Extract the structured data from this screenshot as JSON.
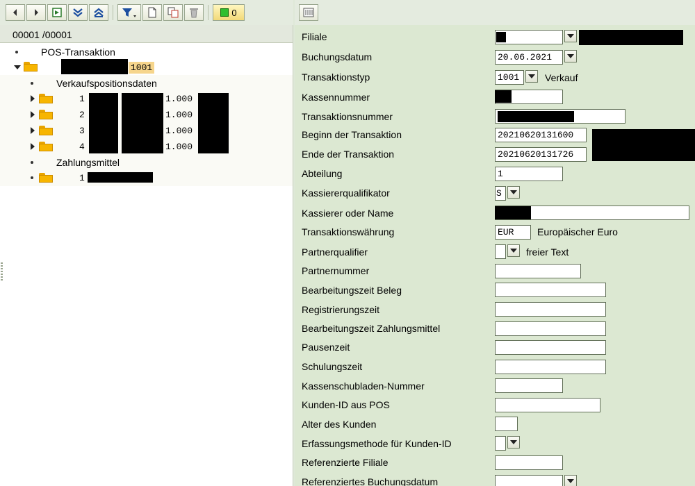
{
  "toolbar": {
    "counter_value": "0"
  },
  "tree": {
    "header": "00001 /00001",
    "root_label": "POS-Transaktion",
    "transaction_number": "1001",
    "sections": {
      "items_label": "Verkaufspositionsdaten",
      "payment_label": "Zahlungsmittel"
    },
    "items": [
      {
        "index": "1",
        "quantity": "1.000"
      },
      {
        "index": "2",
        "quantity": "1.000"
      },
      {
        "index": "3",
        "quantity": "1.000"
      },
      {
        "index": "4",
        "quantity": "1.000"
      }
    ],
    "payment_index": "1"
  },
  "form": {
    "labels": {
      "filiale": "Filiale",
      "buchungsdatum": "Buchungsdatum",
      "transaktionstyp": "Transaktionstyp",
      "kassennummer": "Kassennummer",
      "transaktionsnummer": "Transaktionsnummer",
      "beginn": "Beginn der Transaktion",
      "ende": "Ende der Transaktion",
      "abteilung": "Abteilung",
      "kassiererqualifikator": "Kassiererqualifikator",
      "kassierer": "Kassierer oder Name",
      "waehrung": "Transaktionswährung",
      "partnerqualifier": "Partnerqualifier",
      "partnernummer": "Partnernummer",
      "bz_beleg": "Bearbeitungszeit Beleg",
      "registrierungszeit": "Registrierungszeit",
      "bz_zahlungsmittel": "Bearbeitungszeit Zahlungsmittel",
      "pausenzeit": "Pausenzeit",
      "schulungszeit": "Schulungszeit",
      "schublade": "Kassenschubladen-Nummer",
      "kunden_id": "Kunden-ID aus POS",
      "alter": "Alter des Kunden",
      "erfassungsmethode": "Erfassungsmethode für Kunden-ID",
      "ref_filiale": "Referenzierte Filiale",
      "ref_buchungsdatum": "Referenziertes Buchungsdatum"
    },
    "values": {
      "buchungsdatum": "20.06.2021",
      "transaktionstyp": "1001",
      "transaktionstyp_desc": "Verkauf",
      "beginn": "20210620131600",
      "ende": "20210620131726",
      "abteilung": "1",
      "kassiererqualifikator": "S",
      "waehrung": "EUR",
      "waehrung_desc": "Europäischer Euro",
      "partnerqualifier_desc": "freier Text"
    }
  }
}
